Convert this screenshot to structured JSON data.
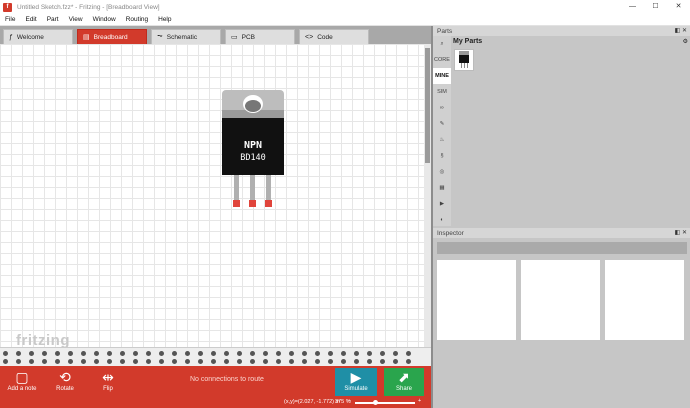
{
  "window": {
    "title": "Untitled Sketch.fzz* - Fritzing - [Breadboard View]",
    "app_icon": "f",
    "min_glyph": "—",
    "max_glyph": "☐",
    "close_glyph": "✕"
  },
  "menu": [
    "File",
    "Edit",
    "Part",
    "View",
    "Window",
    "Routing",
    "Help"
  ],
  "tabs": [
    {
      "label": "Welcome",
      "icon": "ƒ"
    },
    {
      "label": "Breadboard",
      "icon": "▤"
    },
    {
      "label": "Schematic",
      "icon": "⏦"
    },
    {
      "label": "PCB",
      "icon": "▭"
    },
    {
      "label": "Code",
      "icon": "<>"
    }
  ],
  "canvas": {
    "watermark": "fritzing",
    "part": {
      "line1": "NPN",
      "line2": "BD140"
    }
  },
  "toolbar": {
    "add_note": "Add a note",
    "rotate": "Rotate",
    "flip": "Flip",
    "status": "No connections to route",
    "simulate": "Simulate",
    "share": "Share"
  },
  "statusbar": {
    "coords": "(x,y)=(2.027, -1.772) in",
    "zoom": "375 %",
    "zoom_out": "−",
    "zoom_in": "+"
  },
  "parts_panel": {
    "title": "Parts",
    "bin_title": "My Parts",
    "bins": [
      "CORE",
      "MINE",
      "SIM",
      "∞",
      "✎",
      "♨",
      "§",
      "◎",
      "▦",
      "▶",
      "◐",
      "◇"
    ],
    "selected_bin": "MINE",
    "controls": "◧ ✕"
  },
  "inspector": {
    "title": "Inspector",
    "controls": "◧ ✕"
  },
  "colors": {
    "accent": "#d23a2b",
    "simulate": "#1f8fa6",
    "share": "#2aa54d"
  }
}
